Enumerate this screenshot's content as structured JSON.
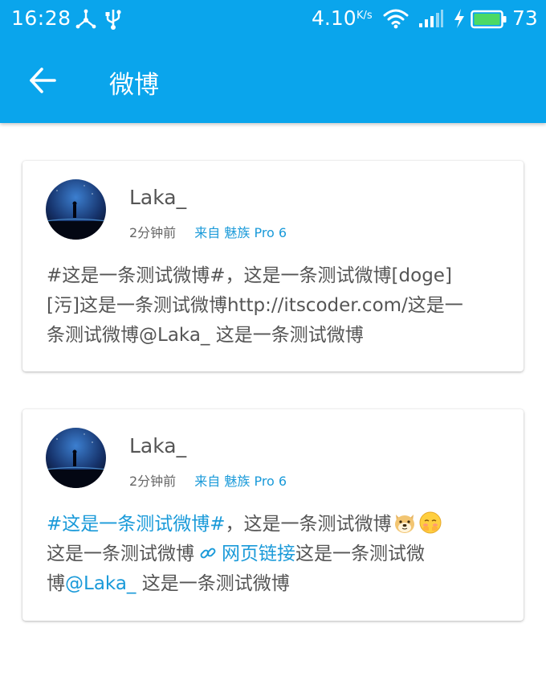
{
  "status_bar": {
    "time": "16:28",
    "network_speed": "4.10",
    "network_speed_unit": "K/s",
    "battery_percent": "73",
    "battery_level": 0.73,
    "icons": [
      "usb-debug-icon",
      "usb-icon",
      "wifi-icon",
      "signal-icon",
      "charging-bolt-icon",
      "battery-icon"
    ]
  },
  "app_bar": {
    "title": "微博",
    "back_icon": "arrow-left-icon"
  },
  "colors": {
    "primary": "#0aa5ec",
    "link": "#1a9ad9",
    "text": "#555555",
    "meta_text": "#666666",
    "battery_fill": "#4cd964"
  },
  "posts": [
    {
      "username": "Laka_",
      "time": "2分钟前",
      "source": "来自 魅族 Pro 6",
      "lines": [
        "#这是一条测试微博#，这是一条测试微博[doge]",
        "[污]这是一条测试微博http://itscoder.com/这是一",
        "条测试微博@Laka_ 这是一条测试微博"
      ]
    },
    {
      "username": "Laka_",
      "time": "2分钟前",
      "source": "来自 魅族 Pro 6",
      "topic": "#这是一条测试微博#",
      "line1_rest": "，这是一条测试微博",
      "emojis": [
        "doge-emoji",
        "blush-emoji"
      ],
      "line2_text": "这是一条测试微博",
      "web_link_icon": "link-icon",
      "web_link_text": "网页链接",
      "line2_rest": "这是一条测试微",
      "line3_start": "博",
      "mention": "@Laka_",
      "line3_rest": " 这是一条测试微博"
    }
  ]
}
